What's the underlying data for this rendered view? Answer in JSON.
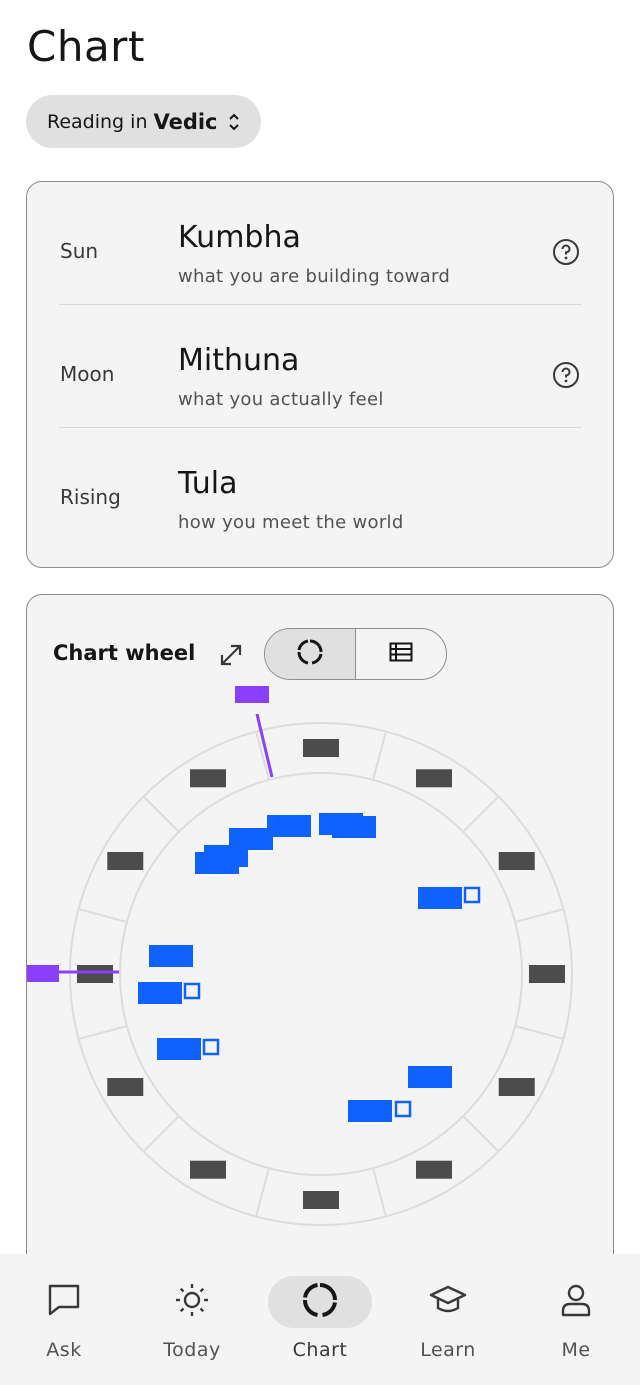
{
  "page": {
    "title": "Chart"
  },
  "reading": {
    "prefix": "Reading in",
    "system": "Vedic"
  },
  "signs": [
    {
      "label": "Sun",
      "sign": "Kumbha",
      "description": "what you are building toward",
      "has_help": true
    },
    {
      "label": "Moon",
      "sign": "Mithuna",
      "description": "what you actually feel",
      "has_help": true
    },
    {
      "label": "Rising",
      "sign": "Tula",
      "description": "how you meet the world",
      "has_help": false
    }
  ],
  "wheel": {
    "title": "Chart wheel",
    "views": [
      "wheel-view",
      "table-view"
    ],
    "active_view": "wheel-view",
    "colors": {
      "planet": "#0f62fe",
      "angle": "#8a3ffc",
      "house_label": "#4c4c4c",
      "ring_line": "#dcdcdc"
    }
  },
  "nav": {
    "items": [
      {
        "label": "Ask",
        "icon": "chat-bubble-icon",
        "active": false
      },
      {
        "label": "Today",
        "icon": "sun-icon",
        "active": false
      },
      {
        "label": "Chart",
        "icon": "chart-ring-icon",
        "active": true
      },
      {
        "label": "Learn",
        "icon": "graduation-cap-icon",
        "active": false
      },
      {
        "label": "Me",
        "icon": "user-icon",
        "active": false
      }
    ]
  }
}
